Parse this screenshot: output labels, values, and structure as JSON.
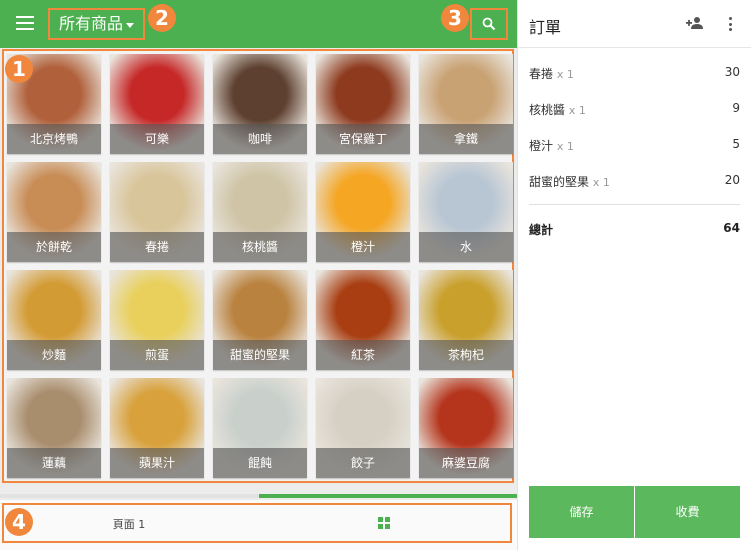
{
  "header": {
    "category_label": "所有商品",
    "accent_color": "#4caf50",
    "highlight_color": "#f0873c"
  },
  "markers": [
    "1",
    "2",
    "3",
    "4"
  ],
  "products": [
    {
      "name": "北京烤鴨",
      "color": "#b0603a"
    },
    {
      "name": "可樂",
      "color": "#c62828"
    },
    {
      "name": "咖啡",
      "color": "#5d4030"
    },
    {
      "name": "宮保雞丁",
      "color": "#8d3a1e"
    },
    {
      "name": "拿鐵",
      "color": "#c9a274"
    },
    {
      "name": "於餅乾",
      "color": "#c88c55"
    },
    {
      "name": "春捲",
      "color": "#d9c59a"
    },
    {
      "name": "核桃醬",
      "color": "#cfc4a6"
    },
    {
      "name": "橙汁",
      "color": "#f5a623"
    },
    {
      "name": "水",
      "color": "#b8c6d4"
    },
    {
      "name": "炒麵",
      "color": "#d39b34"
    },
    {
      "name": "煎蛋",
      "color": "#e9d05c"
    },
    {
      "name": "甜蜜的堅果",
      "color": "#b9823f"
    },
    {
      "name": "紅茶",
      "color": "#a83e12"
    },
    {
      "name": "茶枸杞",
      "color": "#c9a02c"
    },
    {
      "name": "蓮藕",
      "color": "#a98e6e"
    },
    {
      "name": "蘋果汁",
      "color": "#d8a13b"
    },
    {
      "name": "餛飩",
      "color": "#c9d0cc"
    },
    {
      "name": "餃子",
      "color": "#d6d0c4"
    },
    {
      "name": "麻婆豆腐",
      "color": "#b5341c"
    }
  ],
  "footer": {
    "page_label": "頁面 1"
  },
  "order": {
    "title": "訂單",
    "items": [
      {
        "name": "春捲",
        "qty": "x 1",
        "price": "30"
      },
      {
        "name": "核桃醬",
        "qty": "x 1",
        "price": "9"
      },
      {
        "name": "橙汁",
        "qty": "x 1",
        "price": "5"
      },
      {
        "name": "甜蜜的堅果",
        "qty": "x 1",
        "price": "20"
      }
    ],
    "total_label": "總計",
    "total_value": "64",
    "save_label": "儲存",
    "pay_label": "收費"
  }
}
